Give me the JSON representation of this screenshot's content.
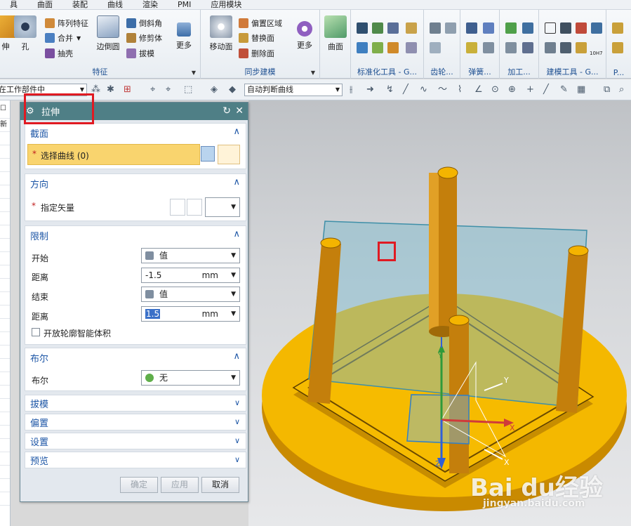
{
  "menu": [
    "具",
    "曲面",
    "装配",
    "曲线",
    "渲染",
    "PMI",
    "应用模块"
  ],
  "ribbon": {
    "feature": {
      "title": "特征",
      "big": [
        "伸",
        "孔",
        "边倒圆"
      ],
      "small": [
        "阵列特征",
        "合并",
        "抽壳",
        "倒斜角",
        "修剪体",
        "拔模"
      ],
      "more": "更多"
    },
    "sync": {
      "title": "同步建模",
      "big": [
        "移动面"
      ],
      "small": [
        "偏置区域",
        "替换面",
        "删除面"
      ],
      "more": "更多"
    },
    "surface": {
      "label": "曲面"
    },
    "extra": [
      "标准化工具 - G...",
      "齿轮...",
      "弹簧...",
      "加工...",
      "建模工具 - G...",
      "P..."
    ],
    "tiny_label": "10H7"
  },
  "toolbar2": {
    "scope": "在工作部件中",
    "curve_rule": "自动判断曲线"
  },
  "left_strip": [
    "新"
  ],
  "dialog": {
    "title": "拉伸",
    "section_label": "截面",
    "select_curve": "选择曲线 (0)",
    "direction_label": "方向",
    "vector_label": "指定矢量",
    "limits_label": "限制",
    "start_label": "开始",
    "start_value": "值",
    "distance_label": "距离",
    "start_distance": "-1.5",
    "unit": "mm",
    "end_label": "结束",
    "end_value": "值",
    "end_distance": "1.5",
    "open_profile": "开放轮廓智能体积",
    "bool_section": "布尔",
    "bool_label": "布尔",
    "bool_value": "无",
    "collapsed": [
      "拔模",
      "偏置",
      "设置",
      "预览"
    ],
    "ok": "确定",
    "apply": "应用",
    "cancel": "取消",
    "required_mark": "*"
  },
  "axes": {
    "x": "X",
    "y": "Y",
    "z": "Z"
  },
  "watermark": {
    "brand": "Bai du经验",
    "url": "jingyan.baidu.com"
  },
  "colors": {
    "accent": "#4f7f86",
    "highlight": "#e01a22",
    "model": "#f2b400",
    "pillar": "#c88a14"
  }
}
